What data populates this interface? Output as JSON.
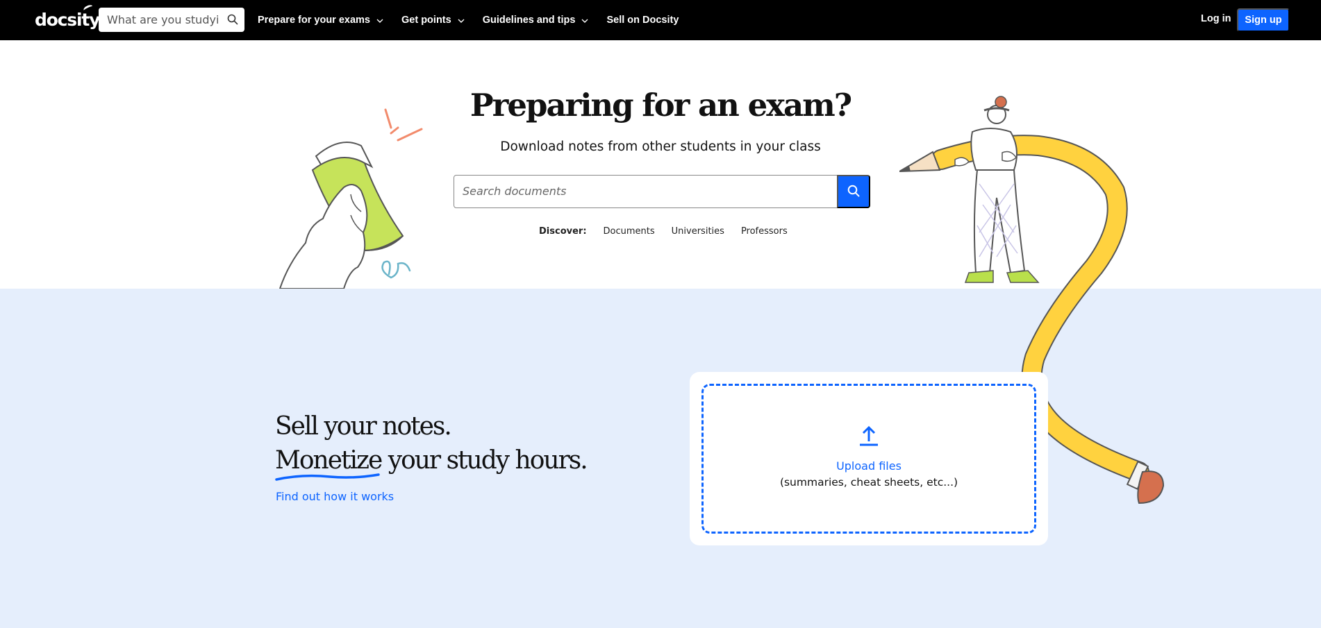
{
  "nav": {
    "logo": "docsity",
    "search_placeholder": "What are you studyi",
    "links": [
      {
        "label": "Prepare for your exams",
        "has_dropdown": true
      },
      {
        "label": "Get points",
        "has_dropdown": true
      },
      {
        "label": "Guidelines and tips",
        "has_dropdown": true
      },
      {
        "label": "Sell on Docsity",
        "has_dropdown": false
      }
    ],
    "login": "Log in",
    "signup": "Sign up"
  },
  "hero": {
    "title": "Preparing for an exam?",
    "subtitle": "Download notes from other students in your class",
    "search_placeholder": "Search documents",
    "discover_label": "Discover:",
    "discover_links": [
      "Documents",
      "Universities",
      "Professors"
    ]
  },
  "sell": {
    "title_line1": "Sell your notes.",
    "title_line2_highlight": "Monetize",
    "title_line2_rest": " your study hours.",
    "link": "Find out how it works"
  },
  "upload": {
    "label": "Upload files",
    "hint": "(summaries, cheat sheets, etc...)"
  },
  "colors": {
    "nav_bg": "#000000",
    "accent": "#0d64ff",
    "sell_bg": "#e5eefc",
    "pencil": "#ffd23f",
    "book": "#c6e35a"
  }
}
